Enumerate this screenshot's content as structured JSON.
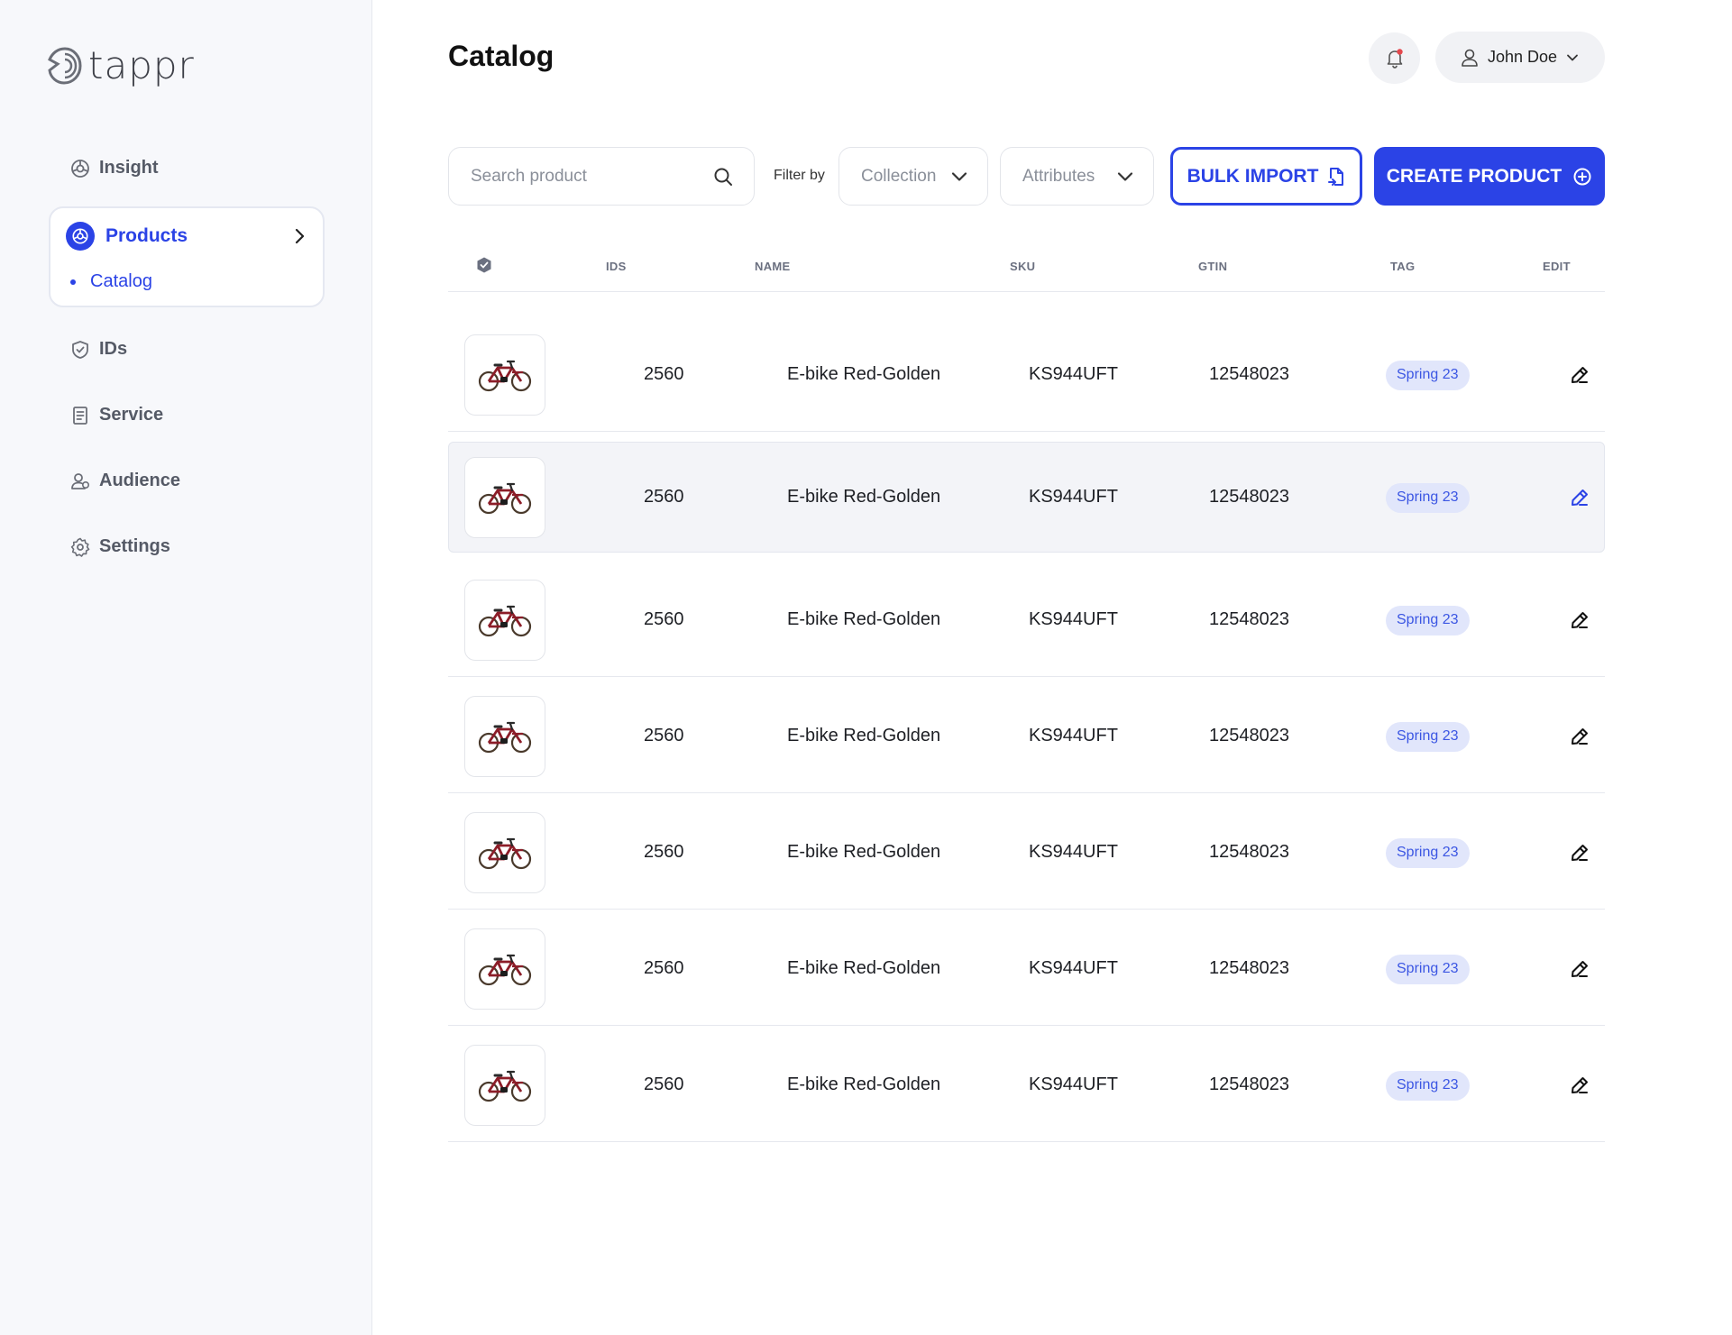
{
  "app": {
    "logo_text": "tappr"
  },
  "sidebar": {
    "items": [
      {
        "key": "insight",
        "label": "Insight",
        "icon": "insight-icon"
      },
      {
        "key": "products",
        "label": "Products",
        "icon": "products-icon",
        "active": true,
        "sub": [
          {
            "label": "Catalog"
          }
        ]
      },
      {
        "key": "ids",
        "label": "IDs",
        "icon": "shield-icon"
      },
      {
        "key": "service",
        "label": "Service",
        "icon": "document-icon"
      },
      {
        "key": "audience",
        "label": "Audience",
        "icon": "users-icon"
      },
      {
        "key": "settings",
        "label": "Settings",
        "icon": "gear-icon"
      }
    ]
  },
  "header": {
    "title": "Catalog",
    "user_name": "John Doe"
  },
  "toolbar": {
    "search_placeholder": "Search product",
    "filter_label": "Filter by",
    "collection_label": "Collection",
    "attributes_label": "Attributes",
    "bulk_import_label": "BULK IMPORT",
    "create_product_label": "CREATE PRODUCT"
  },
  "table": {
    "columns": [
      "IDS",
      "NAME",
      "SKU",
      "GTIN",
      "TAG",
      "EDIT"
    ],
    "rows": [
      {
        "id": "2560",
        "name": "E-bike Red-Golden",
        "sku": "KS944UFT",
        "gtin": "12548023",
        "tag": "Spring 23"
      },
      {
        "id": "2560",
        "name": "E-bike Red-Golden",
        "sku": "KS944UFT",
        "gtin": "12548023",
        "tag": "Spring 23"
      },
      {
        "id": "2560",
        "name": "E-bike Red-Golden",
        "sku": "KS944UFT",
        "gtin": "12548023",
        "tag": "Spring 23"
      },
      {
        "id": "2560",
        "name": "E-bike Red-Golden",
        "sku": "KS944UFT",
        "gtin": "12548023",
        "tag": "Spring 23"
      },
      {
        "id": "2560",
        "name": "E-bike Red-Golden",
        "sku": "KS944UFT",
        "gtin": "12548023",
        "tag": "Spring 23"
      },
      {
        "id": "2560",
        "name": "E-bike Red-Golden",
        "sku": "KS944UFT",
        "gtin": "12548023",
        "tag": "Spring 23"
      },
      {
        "id": "2560",
        "name": "E-bike Red-Golden",
        "sku": "KS944UFT",
        "gtin": "12548023",
        "tag": "Spring 23"
      }
    ]
  },
  "colors": {
    "accent": "#2b43e6",
    "tag_bg": "#e1e6fb",
    "notification": "#e5484d"
  }
}
